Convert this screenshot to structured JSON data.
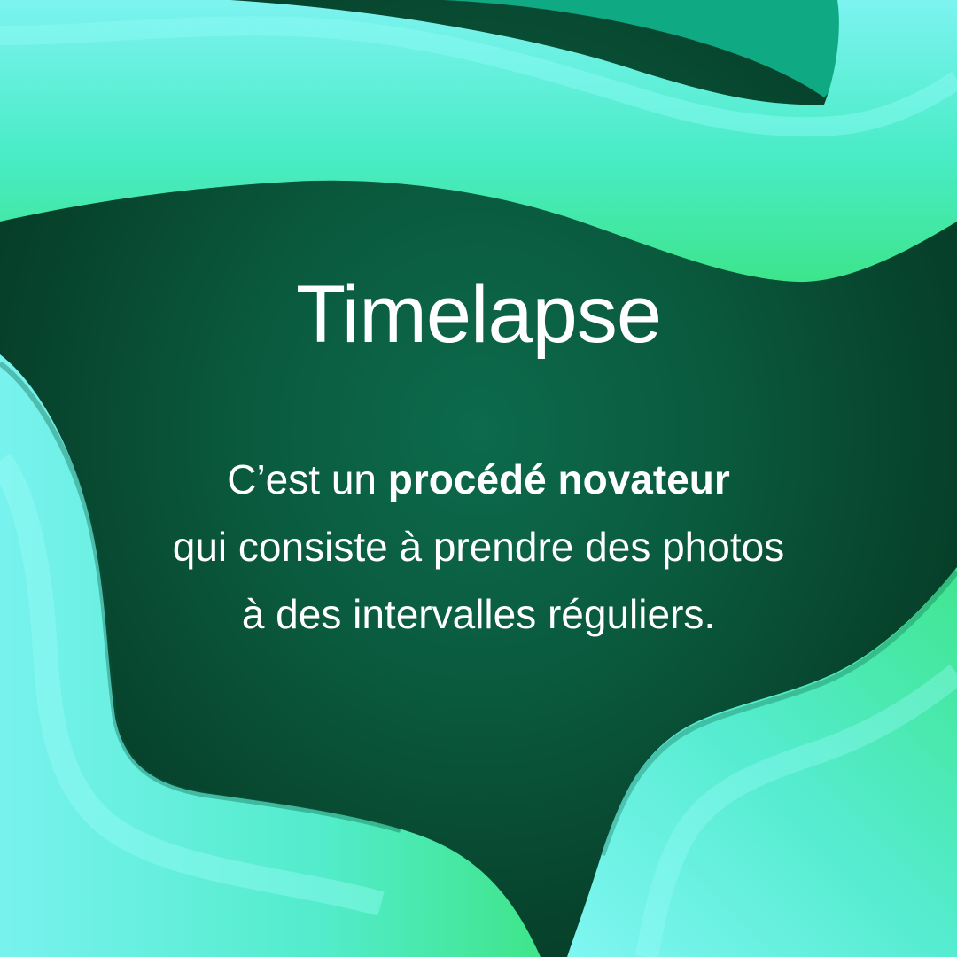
{
  "title": "Timelapse",
  "body": {
    "line1_before": "C’est un ",
    "line1_bold": "procédé novateur",
    "line2": "qui consiste à prendre des photos",
    "line3": "à des intervalles réguliers."
  },
  "colors": {
    "background_dark": "#05301f",
    "background_mid": "#0d6a4c",
    "tube_light": "#7af5ef",
    "tube_green": "#3fe58a",
    "text": "#ffffff"
  }
}
